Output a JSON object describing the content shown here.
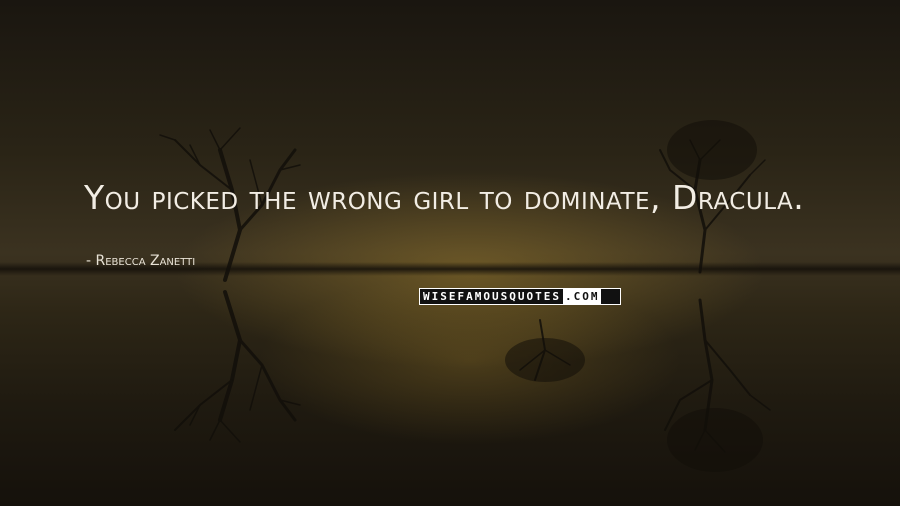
{
  "quote": {
    "text": "You picked the wrong girl to dominate, Dracula.",
    "author": "- Rebecca Zanetti"
  },
  "watermark": {
    "main": "WISEFAMOUSQUOTES",
    "tld": ".COM"
  },
  "colors": {
    "text": "#f2ede4",
    "background_dark": "#1b160f",
    "glow": "#9a7a2d"
  }
}
